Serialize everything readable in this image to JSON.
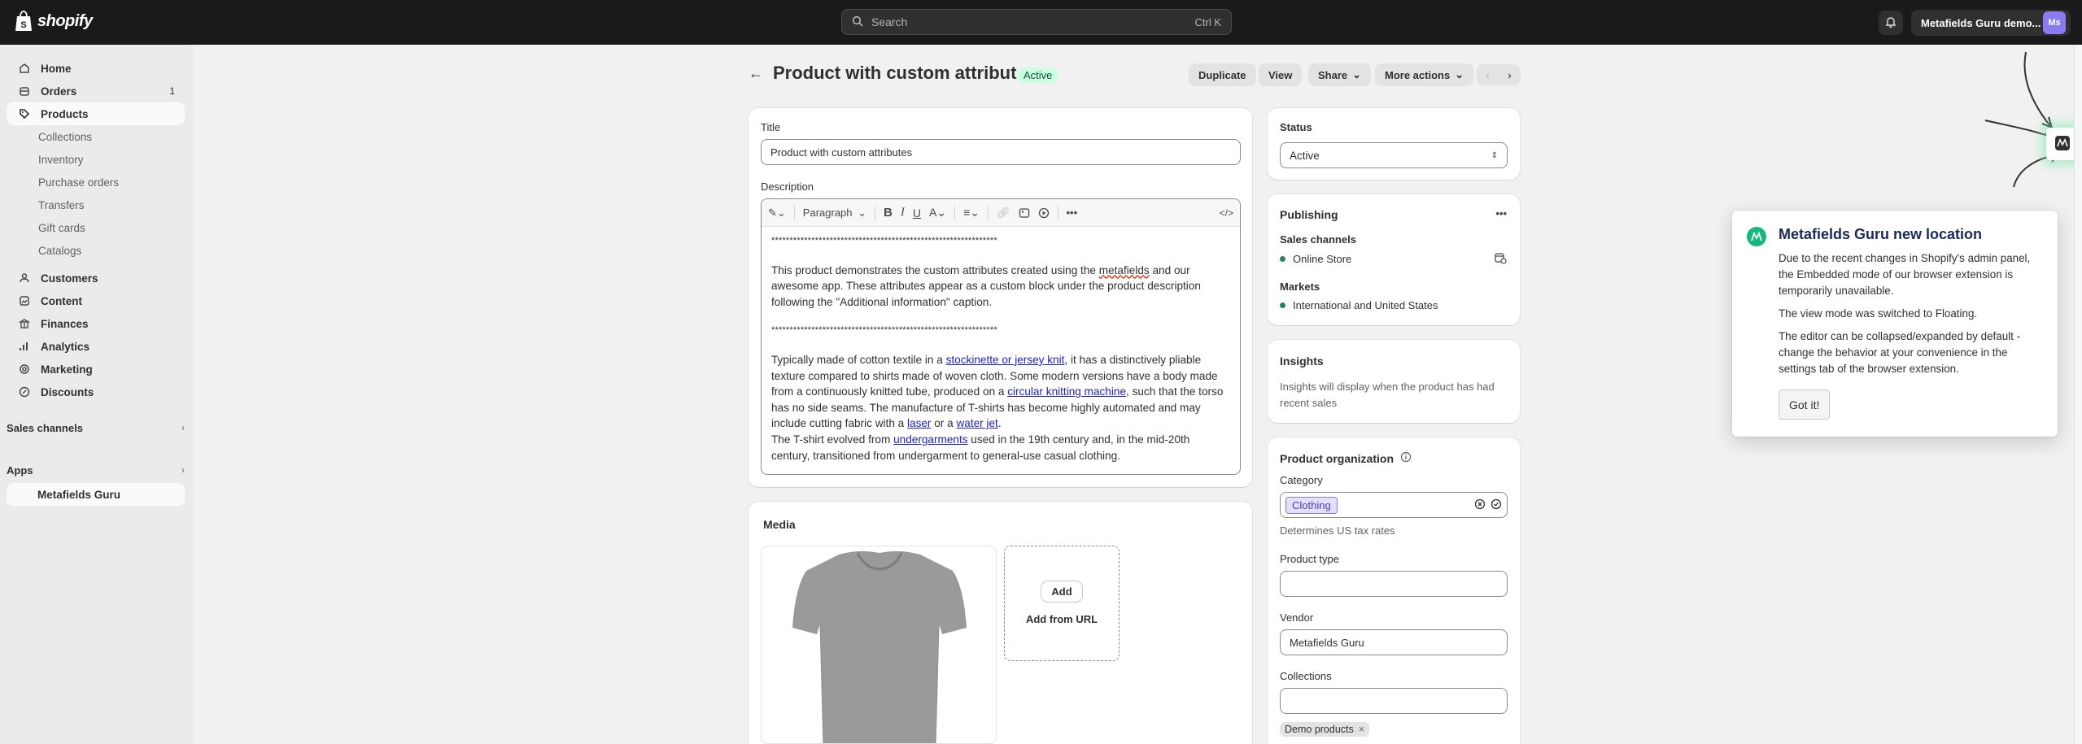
{
  "topbar": {
    "logo_text": "shopify",
    "search_placeholder": "Search",
    "search_shortcut": "Ctrl K",
    "store_name": "Metafields Guru demo...",
    "avatar_initials": "Ms"
  },
  "sidebar": {
    "home": "Home",
    "orders": "Orders",
    "orders_count": "1",
    "products": "Products",
    "product_subitems": [
      "Collections",
      "Inventory",
      "Purchase orders",
      "Transfers",
      "Gift cards",
      "Catalogs"
    ],
    "customers": "Customers",
    "content": "Content",
    "finances": "Finances",
    "analytics": "Analytics",
    "marketing": "Marketing",
    "discounts": "Discounts",
    "sales_channels": "Sales channels",
    "apps": "Apps",
    "app_item": "Metafields Guru"
  },
  "header": {
    "title": "Product with custom attributes",
    "status_badge": "Active",
    "duplicate": "Duplicate",
    "view": "View",
    "share": "Share",
    "more_actions": "More actions"
  },
  "product": {
    "title_label": "Title",
    "title_value": "Product with custom attributes",
    "description_label": "Description",
    "toolbar_paragraph": "Paragraph",
    "stars_1": "**************************************************************",
    "para1": [
      "This product demonstrates the custom attributes created using the ",
      "metafields",
      " and our awesome app. These attributes appear as a custom block under the product description following the \"Additional information\" caption."
    ],
    "stars_2": "**************************************************************",
    "para2_a": "Typically made of cotton textile in a ",
    "link_stockinette": "stockinette or jersey knit",
    "para2_b": ", it has a distinctively pliable texture compared to shirts made of woven cloth. Some modern versions have a body made from a continuously knitted tube, produced on a ",
    "link_circular": "circular knitting machine",
    "para2_c": ", such that the torso has no side seams. The manufacture of T-shirts has become highly automated and may include cutting fabric with a ",
    "link_laser": "laser",
    "para2_d": " or a ",
    "link_waterjet": "water jet",
    "para2_e": ".",
    "para3_a": "The T-shirt evolved from ",
    "link_undergarments": "undergarments",
    "para3_b": " used in the 19th century and, in the mid-20th century, transitioned from undergarment to general-use casual clothing.",
    "media_title": "Media",
    "media_add": "Add",
    "media_add_url": "Add from URL"
  },
  "status_card": {
    "label": "Status",
    "value": "Active"
  },
  "publishing": {
    "title": "Publishing",
    "sales_channels_label": "Sales channels",
    "channel": "Online Store",
    "markets_label": "Markets",
    "market": "International and United States"
  },
  "insights": {
    "title": "Insights",
    "text": "Insights will display when the product has had recent sales"
  },
  "organization": {
    "title": "Product organization",
    "category_label": "Category",
    "category_value": "Clothing",
    "category_help": "Determines US tax rates",
    "type_label": "Product type",
    "vendor_label": "Vendor",
    "vendor_value": "Metafields Guru",
    "collections_label": "Collections",
    "collection_tag": "Demo products"
  },
  "popup": {
    "title": "Metafields Guru new location",
    "p1": "Due to the recent changes in Shopify's admin panel, the Embedded mode of our browser extension is temporarily unavailable.",
    "p2": "The view mode was switched to Floating.",
    "p3": "The editor can be collapsed/expanded by default - change the behavior at your convenience in the settings tab of the browser extension.",
    "button": "Got it!"
  },
  "colors": {
    "topbar": "#1a1a1a",
    "sidebar": "#ebebeb",
    "background": "#f1f1f1",
    "active_badge_bg": "#cdfee1",
    "link": "#1f1fb8",
    "brand_green": "#15b87a"
  }
}
